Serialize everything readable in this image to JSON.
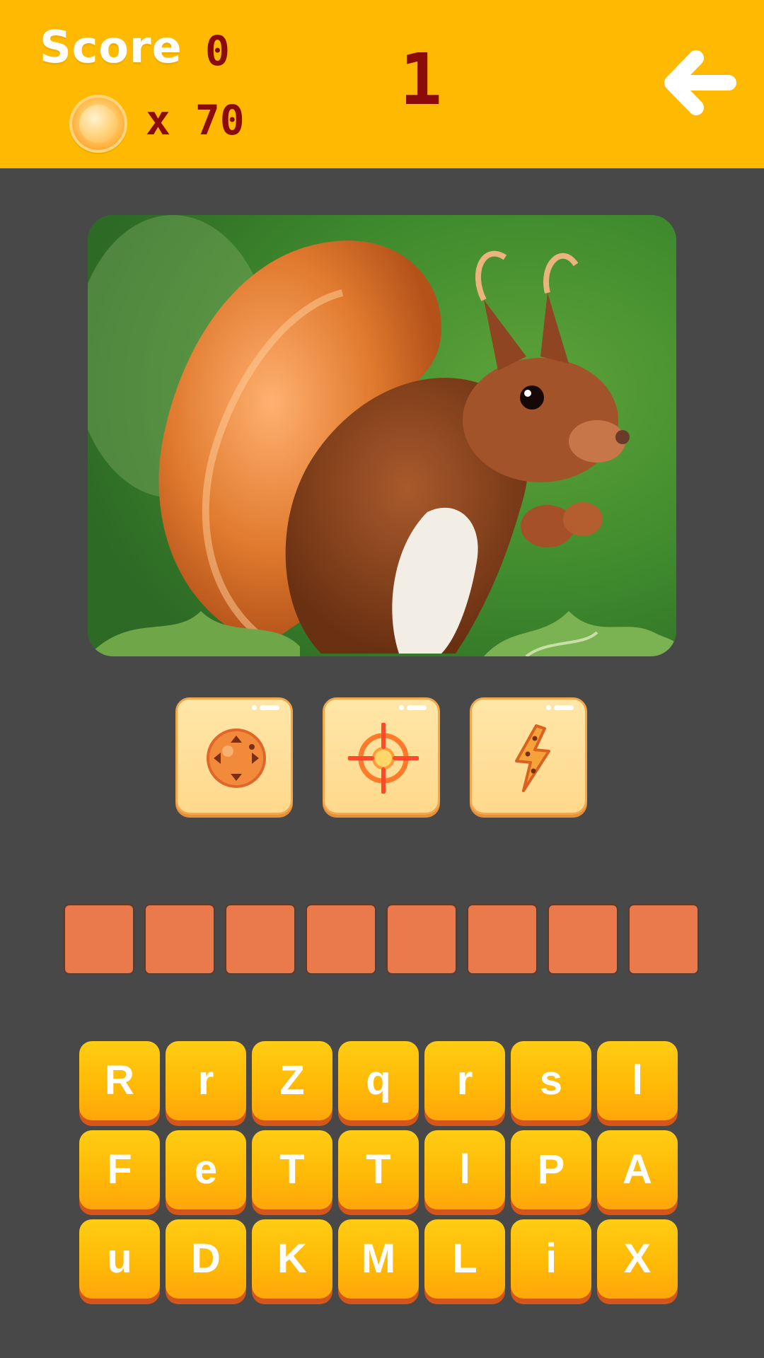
{
  "header": {
    "score_label": "Score",
    "score_value": "0",
    "coin_prefix": "x",
    "coin_count": "70",
    "level": "1",
    "back_icon": "arrow-left-icon"
  },
  "puzzle": {
    "image_subject": "squirrel"
  },
  "hints": [
    {
      "icon": "cookie-icon"
    },
    {
      "icon": "crosshair-target-icon"
    },
    {
      "icon": "lightning-bolt-icon"
    }
  ],
  "answer_slots": [
    "",
    "",
    "",
    "",
    "",
    "",
    "",
    ""
  ],
  "keyboard": {
    "rows": [
      [
        "R",
        "r",
        "Z",
        "q",
        "r",
        "s",
        "l"
      ],
      [
        "F",
        "e",
        "T",
        "T",
        "l",
        "P",
        "A"
      ],
      [
        "u",
        "D",
        "K",
        "M",
        "L",
        "i",
        "X"
      ]
    ]
  },
  "colors": {
    "header_bg": "#ffba00",
    "page_bg": "#484848",
    "accent_text": "#8b0a0a",
    "slot_fill": "#ea794b",
    "key_fill": "#ffba07",
    "key_shadow": "#d4561a"
  }
}
